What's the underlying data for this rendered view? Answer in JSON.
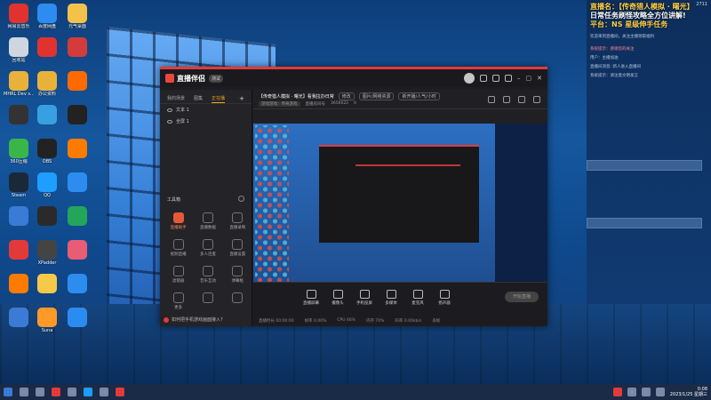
{
  "desktop": {
    "icons": [
      {
        "label": "网易云音乐",
        "color": "#e0332f"
      },
      {
        "label": "百度网盘",
        "color": "#2d8cf0"
      },
      {
        "label": "元气桌面",
        "color": "#f3c24b"
      },
      {
        "label": "回收站",
        "color": "#d0d6e0"
      },
      {
        "label": "",
        "color": "#e0332f"
      },
      {
        "label": "",
        "color": "#d43b3b"
      },
      {
        "label": "MHRL Dev s...",
        "color": "#e8b23a"
      },
      {
        "label": "办公资料",
        "color": "#e8b23a"
      },
      {
        "label": "",
        "color": "#ff6a00"
      },
      {
        "label": "",
        "color": "#333"
      },
      {
        "label": "",
        "color": "#38a0e0"
      },
      {
        "label": "",
        "color": "#222"
      },
      {
        "label": "360压缩",
        "color": "#39b54a"
      },
      {
        "label": "OBS",
        "color": "#222"
      },
      {
        "label": "",
        "color": "#ff7b00"
      },
      {
        "label": "Steam",
        "color": "#1b2838"
      },
      {
        "label": "QQ",
        "color": "#1e9eff"
      },
      {
        "label": "",
        "color": "#2d8cf0"
      },
      {
        "label": "",
        "color": "#3a7bd5"
      },
      {
        "label": "",
        "color": "#2a2a2a"
      },
      {
        "label": "",
        "color": "#23a55a"
      },
      {
        "label": "",
        "color": "#e23a3a"
      },
      {
        "label": "XPadder",
        "color": "#444"
      },
      {
        "label": "",
        "color": "#e85d75"
      },
      {
        "label": "",
        "color": "#ff7b00"
      },
      {
        "label": "",
        "color": "#f7c948"
      },
      {
        "label": "",
        "color": "#2d8cf0"
      },
      {
        "label": "",
        "color": "#3a7bd5"
      },
      {
        "label": "Suna",
        "color": "#ff9a2a"
      },
      {
        "label": "",
        "color": "#2a8cf0"
      }
    ]
  },
  "app": {
    "name": "直播伴侣",
    "version": "测试",
    "left_tabs": [
      "我的场景",
      "图集",
      "正在播"
    ],
    "scenes": [
      "文本 1",
      "全屏 1"
    ],
    "tools_title": "工具箱",
    "tools": [
      {
        "label": "直播助手",
        "hot": true
      },
      {
        "label": "直播数据",
        "hot": false
      },
      {
        "label": "直播录制",
        "hot": false
      },
      {
        "label": "视频直播",
        "hot": false
      },
      {
        "label": "多人连麦",
        "hot": false
      },
      {
        "label": "直播设置",
        "hot": false
      },
      {
        "label": "滤镜器",
        "hot": false
      },
      {
        "label": "音乐互动",
        "hot": false
      },
      {
        "label": "弹幕框",
        "hot": false
      },
      {
        "label": "更多",
        "hot": false
      },
      {
        "label": "",
        "hot": false
      },
      {
        "label": "",
        "hot": false
      }
    ],
    "bottom_tip": "如何把手机游戏画面接入?",
    "info": {
      "title": "【传奇猎人模拟 · 曙光】看我拉办日常",
      "edit_chip": "修改",
      "chip2": "图片/网络资源",
      "chip3": "新开播/人气/小时",
      "category_tag": "游戏游戏：传奇游戏",
      "room_label": "直播房间号",
      "room_id": "3656022",
      "likes": "0"
    },
    "controls": [
      "直播屏幕",
      "摄像头",
      "手机投屏",
      "多媒体",
      "麦克风",
      "扬声器"
    ],
    "start_button": "开始直播",
    "status": [
      "直播时长 00:00:00",
      "帧率 0.00%",
      "CPU 46%",
      "内存 70%",
      "码率 0.00kb/s",
      "丢帧"
    ]
  },
  "right_panel": {
    "banner_line1": "直播名：【传奇猎人模拟 · 曙光】",
    "banner_line2": "日常任务刷怪攻略全方位讲解!",
    "banner_line3": "平台：NS 星级伸手任务",
    "counter": "2711",
    "lines": [
      "欢迎来到直播间，关注主播领取福利",
      "",
      "系统提示：感谢您的关注",
      "用户：主播加油",
      "直播间消息: 新人进入直播间",
      "系统提示：请注意文明发言"
    ]
  },
  "taskbar": {
    "time": "0:08",
    "date": "2023/1/25 星期三"
  }
}
